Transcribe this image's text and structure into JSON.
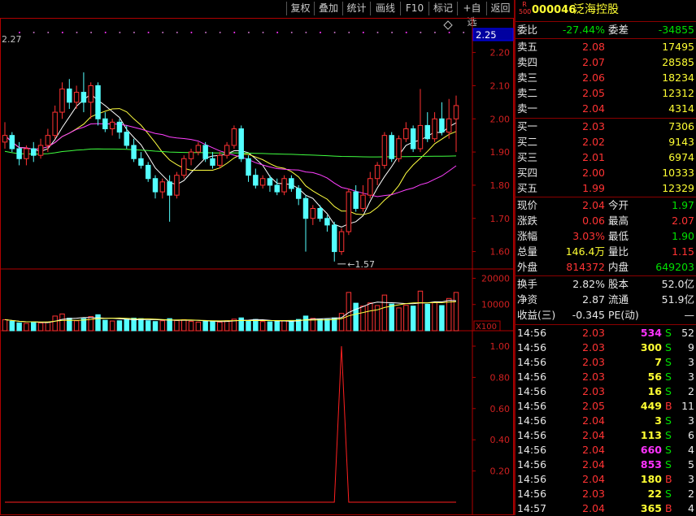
{
  "toolbar": {
    "buttons": [
      "复权",
      "叠加",
      "统计",
      "画线",
      "F10",
      "标记",
      "+自选",
      "返回"
    ]
  },
  "stock": {
    "badge_top": "R",
    "badge_bottom": "500",
    "code": "000046",
    "name": "泛海控股"
  },
  "main_chart": {
    "label_top_left": "2.27",
    "price_box": "2.25",
    "price_ticks": [
      "2.20",
      "2.10",
      "2.00",
      "1.90",
      "1.80",
      "1.70",
      "1.60"
    ],
    "low_marker": "1.57",
    "diamond_icon": "diamond-icon"
  },
  "volume_chart": {
    "ticks": [
      "20000",
      "10000"
    ],
    "unit": "X100"
  },
  "indicator_chart": {
    "ticks": [
      "1.00",
      "0.80",
      "0.60",
      "0.40",
      "0.20"
    ]
  },
  "chart_data": [
    {
      "type": "candlestick",
      "y_range": [
        1.55,
        2.27
      ],
      "ma_lines": [
        "MA5 white",
        "MA10 yellow",
        "MA20 magenta",
        "MA60 green"
      ],
      "candles": [
        [
          1.93,
          1.95,
          1.99,
          1.91
        ],
        [
          1.95,
          1.91,
          1.96,
          1.9
        ],
        [
          1.91,
          1.88,
          1.93,
          1.86
        ],
        [
          1.88,
          1.91,
          1.92,
          1.86
        ],
        [
          1.91,
          1.89,
          1.93,
          1.87
        ],
        [
          1.89,
          1.92,
          1.94,
          1.88
        ],
        [
          1.92,
          1.95,
          1.97,
          1.9
        ],
        [
          1.95,
          2.02,
          2.04,
          1.94
        ],
        [
          2.02,
          2.09,
          2.11,
          2.0
        ],
        [
          2.09,
          2.05,
          2.12,
          2.03
        ],
        [
          2.05,
          2.08,
          2.1,
          2.03
        ],
        [
          2.08,
          2.05,
          2.14,
          2.02
        ],
        [
          2.05,
          2.1,
          2.11,
          2.0
        ],
        [
          2.1,
          2.0,
          2.11,
          1.98
        ],
        [
          2.0,
          1.97,
          2.02,
          1.96
        ],
        [
          1.97,
          1.99,
          2.0,
          1.95
        ],
        [
          1.99,
          1.96,
          2.0,
          1.94
        ],
        [
          1.96,
          1.92,
          1.98,
          1.91
        ],
        [
          1.92,
          1.88,
          1.94,
          1.87
        ],
        [
          1.88,
          1.86,
          1.9,
          1.85
        ],
        [
          1.86,
          1.82,
          1.87,
          1.81
        ],
        [
          1.82,
          1.78,
          1.83,
          1.76
        ],
        [
          1.78,
          1.81,
          1.82,
          1.76
        ],
        [
          1.81,
          1.77,
          1.83,
          1.69
        ],
        [
          1.77,
          1.83,
          1.84,
          1.76
        ],
        [
          1.83,
          1.88,
          1.89,
          1.82
        ],
        [
          1.88,
          1.9,
          1.91,
          1.86
        ],
        [
          1.9,
          1.92,
          1.93,
          1.89
        ],
        [
          1.92,
          1.88,
          1.93,
          1.87
        ],
        [
          1.88,
          1.86,
          1.9,
          1.85
        ],
        [
          1.86,
          1.89,
          1.9,
          1.85
        ],
        [
          1.89,
          1.92,
          1.93,
          1.88
        ],
        [
          1.92,
          1.97,
          1.98,
          1.91
        ],
        [
          1.97,
          1.88,
          1.98,
          1.87
        ],
        [
          1.88,
          1.83,
          1.89,
          1.81
        ],
        [
          1.83,
          1.8,
          1.85,
          1.79
        ],
        [
          1.8,
          1.82,
          1.83,
          1.79
        ],
        [
          1.82,
          1.8,
          1.83,
          1.78
        ],
        [
          1.8,
          1.78,
          1.82,
          1.77
        ],
        [
          1.78,
          1.82,
          1.83,
          1.77
        ],
        [
          1.82,
          1.79,
          1.83,
          1.78
        ],
        [
          1.79,
          1.76,
          1.8,
          1.74
        ],
        [
          1.76,
          1.7,
          1.77,
          1.6
        ],
        [
          1.7,
          1.73,
          1.74,
          1.68
        ],
        [
          1.73,
          1.7,
          1.74,
          1.69
        ],
        [
          1.7,
          1.68,
          1.71,
          1.66
        ],
        [
          1.68,
          1.6,
          1.69,
          1.57
        ],
        [
          1.6,
          1.66,
          1.67,
          1.59
        ],
        [
          1.66,
          1.78,
          1.79,
          1.65
        ],
        [
          1.78,
          1.73,
          1.8,
          1.72
        ],
        [
          1.73,
          1.77,
          1.8,
          1.72
        ],
        [
          1.77,
          1.82,
          1.84,
          1.76
        ],
        [
          1.82,
          1.86,
          1.87,
          1.8
        ],
        [
          1.86,
          1.95,
          1.96,
          1.85
        ],
        [
          1.95,
          1.88,
          1.96,
          1.87
        ],
        [
          1.88,
          1.94,
          1.95,
          1.87
        ],
        [
          1.94,
          1.97,
          1.99,
          1.93
        ],
        [
          1.97,
          1.91,
          1.98,
          1.9
        ],
        [
          1.91,
          1.98,
          2.09,
          1.9
        ],
        [
          1.98,
          1.94,
          2.02,
          1.93
        ],
        [
          1.94,
          2.0,
          2.02,
          1.93
        ],
        [
          2.0,
          1.96,
          2.05,
          1.95
        ],
        [
          1.96,
          2.0,
          2.06,
          1.94
        ],
        [
          2.0,
          2.04,
          2.07,
          1.9
        ]
      ]
    },
    {
      "type": "bar",
      "y_range": [
        0,
        22000
      ],
      "values": [
        4200,
        3600,
        3000,
        2800,
        3400,
        3000,
        3300,
        5600,
        6400,
        4800,
        3800,
        4600,
        5400,
        6100,
        4000,
        3700,
        3800,
        4400,
        4800,
        4600,
        3800,
        3500,
        3800,
        4600,
        3900,
        4200,
        3600,
        3300,
        3700,
        3600,
        3300,
        3800,
        4400,
        4900,
        3800,
        4300,
        3500,
        3400,
        3600,
        3800,
        3600,
        4300,
        5600,
        4700,
        4400,
        4300,
        4900,
        6600,
        14600,
        10500,
        9400,
        10600,
        9600,
        13600,
        10200,
        8700,
        9700,
        9400,
        15100,
        10100,
        10800,
        9600,
        12300,
        14600
      ]
    },
    {
      "type": "line",
      "y_range": [
        0,
        1.0
      ],
      "values": [
        0,
        0,
        0,
        0,
        0,
        0,
        0,
        0,
        0,
        0,
        0,
        0,
        0,
        0,
        0,
        0,
        0,
        0,
        0,
        0,
        0,
        0,
        0,
        0,
        0,
        0,
        0,
        0,
        0,
        0,
        0,
        0,
        0,
        0,
        0,
        0,
        0,
        0,
        0,
        0,
        0,
        0,
        0,
        0,
        0,
        0,
        0,
        1.0,
        0,
        0,
        0,
        0,
        0,
        0,
        0,
        0,
        0,
        0,
        0,
        0,
        0,
        0,
        0,
        0
      ]
    }
  ],
  "quote": {
    "weibi_label": "委比",
    "weibi_value": "-27.44%",
    "weicha_label": "委差",
    "weicha_value": "-34855",
    "sell": [
      {
        "label": "卖五",
        "price": "2.08",
        "vol": "17495"
      },
      {
        "label": "卖四",
        "price": "2.07",
        "vol": "28585"
      },
      {
        "label": "卖三",
        "price": "2.06",
        "vol": "18234"
      },
      {
        "label": "卖二",
        "price": "2.05",
        "vol": "12312"
      },
      {
        "label": "卖一",
        "price": "2.04",
        "vol": "4314"
      }
    ],
    "buy": [
      {
        "label": "买一",
        "price": "2.03",
        "vol": "7306"
      },
      {
        "label": "买二",
        "price": "2.02",
        "vol": "9143"
      },
      {
        "label": "买三",
        "price": "2.01",
        "vol": "6974"
      },
      {
        "label": "买四",
        "price": "2.00",
        "vol": "10333"
      },
      {
        "label": "买五",
        "price": "1.99",
        "vol": "12329"
      }
    ],
    "stats": [
      {
        "l1": "现价",
        "v1": "2.04",
        "c1": "red",
        "l2": "今开",
        "v2": "1.97",
        "c2": "green"
      },
      {
        "l1": "涨跌",
        "v1": "0.06",
        "c1": "red",
        "l2": "最高",
        "v2": "2.07",
        "c2": "red"
      },
      {
        "l1": "涨幅",
        "v1": "3.03%",
        "c1": "red",
        "l2": "最低",
        "v2": "1.90",
        "c2": "green"
      },
      {
        "l1": "总量",
        "v1": "146.4万",
        "c1": "yellow",
        "l2": "量比",
        "v2": "1.15",
        "c2": "red"
      },
      {
        "l1": "外盘",
        "v1": "814372",
        "c1": "red",
        "l2": "内盘",
        "v2": "649203",
        "c2": "green"
      }
    ],
    "fund": [
      {
        "l1": "换手",
        "v1": "2.82%",
        "l2": "股本",
        "v2": "52.0亿"
      },
      {
        "l1": "净资",
        "v1": "2.87",
        "l2": "流通",
        "v2": "51.9亿"
      },
      {
        "l1": "收益(三)",
        "v1": "-0.345",
        "l2": "PE(动)",
        "v2": "—"
      }
    ]
  },
  "ticks": [
    {
      "time": "14:56",
      "price": "2.03",
      "vol": "534",
      "side": "S",
      "n": "52"
    },
    {
      "time": "14:56",
      "price": "2.03",
      "vol": "300",
      "side": "S",
      "n": "9"
    },
    {
      "time": "14:56",
      "price": "2.03",
      "vol": "7",
      "side": "S",
      "n": "3"
    },
    {
      "time": "14:56",
      "price": "2.03",
      "vol": "56",
      "side": "S",
      "n": "3"
    },
    {
      "time": "14:56",
      "price": "2.03",
      "vol": "16",
      "side": "S",
      "n": "2"
    },
    {
      "time": "14:56",
      "price": "2.05",
      "vol": "449",
      "side": "B",
      "n": "11"
    },
    {
      "time": "14:56",
      "price": "2.04",
      "vol": "3",
      "side": "S",
      "n": "3"
    },
    {
      "time": "14:56",
      "price": "2.04",
      "vol": "113",
      "side": "S",
      "n": "6"
    },
    {
      "time": "14:56",
      "price": "2.04",
      "vol": "660",
      "side": "S",
      "n": "4"
    },
    {
      "time": "14:56",
      "price": "2.04",
      "vol": "853",
      "side": "S",
      "n": "5"
    },
    {
      "time": "14:56",
      "price": "2.04",
      "vol": "180",
      "side": "B",
      "n": "3"
    },
    {
      "time": "14:56",
      "price": "2.03",
      "vol": "22",
      "side": "S",
      "n": "2"
    },
    {
      "time": "14:57",
      "price": "2.04",
      "vol": "365",
      "side": "B",
      "n": "4"
    }
  ],
  "colors": {
    "up": "#ff3232",
    "down": "#54ffff",
    "bg": "#000000",
    "border": "#b00000"
  }
}
